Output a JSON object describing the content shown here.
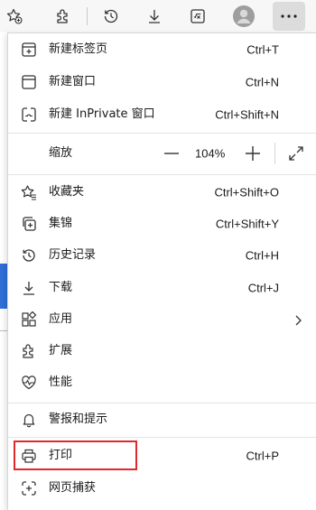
{
  "toolbar": {
    "icons": [
      "favorites-add-icon",
      "extensions-icon",
      "history-icon",
      "downloads-icon",
      "math-solver-icon",
      "profile-avatar-icon",
      "more-icon"
    ]
  },
  "menu": {
    "new_tab": {
      "label": "新建标签页",
      "shortcut": "Ctrl+T"
    },
    "new_window": {
      "label": "新建窗口",
      "shortcut": "Ctrl+N"
    },
    "new_inprivate": {
      "label": "新建 InPrivate 窗口",
      "shortcut": "Ctrl+Shift+N"
    },
    "zoom": {
      "label": "缩放",
      "value": "104%"
    },
    "favorites": {
      "label": "收藏夹",
      "shortcut": "Ctrl+Shift+O"
    },
    "collections": {
      "label": "集锦",
      "shortcut": "Ctrl+Shift+Y"
    },
    "history": {
      "label": "历史记录",
      "shortcut": "Ctrl+H"
    },
    "downloads": {
      "label": "下载",
      "shortcut": "Ctrl+J"
    },
    "apps": {
      "label": "应用"
    },
    "extensions": {
      "label": "扩展"
    },
    "performance": {
      "label": "性能"
    },
    "alerts": {
      "label": "警报和提示"
    },
    "print": {
      "label": "打印",
      "shortcut": "Ctrl+P"
    },
    "web_capture": {
      "label": "网页捕获"
    }
  },
  "colors": {
    "highlight": "#e0282e",
    "menu_bg": "#ffffff",
    "toolbar_bg": "#f7f7f7"
  }
}
